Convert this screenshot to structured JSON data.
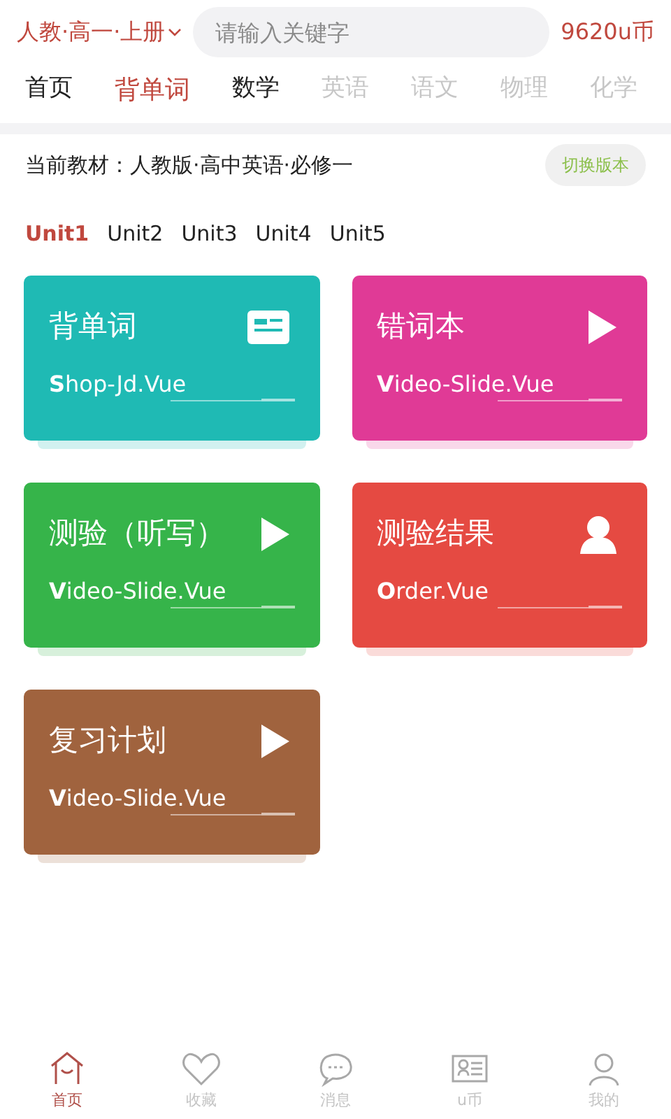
{
  "header": {
    "book_selector": "人教·高一·上册",
    "search": {
      "placeholder": "请输入关键字"
    },
    "coins": "9620u币"
  },
  "subject_tabs": [
    {
      "label": "首页",
      "selected": false,
      "dim": false
    },
    {
      "label": "背单词",
      "selected": true,
      "dim": false
    },
    {
      "label": "数学",
      "selected": false,
      "dim": false
    },
    {
      "label": "英语",
      "selected": false,
      "dim": true
    },
    {
      "label": "语文",
      "selected": false,
      "dim": true
    },
    {
      "label": "物理",
      "selected": false,
      "dim": true
    },
    {
      "label": "化学",
      "selected": false,
      "dim": true
    }
  ],
  "textbook": {
    "label": "当前教材：人教版·高中英语·必修一",
    "switch_button": "切换版本"
  },
  "units": [
    {
      "label": "Unit1",
      "selected": true
    },
    {
      "label": "Unit2",
      "selected": false
    },
    {
      "label": "Unit3",
      "selected": false
    },
    {
      "label": "Unit4",
      "selected": false
    },
    {
      "label": "Unit5",
      "selected": false
    }
  ],
  "cards": [
    {
      "title": "背单词",
      "subtitle": "**S**hop-Jd.Vue",
      "color": "#1fbab4",
      "kind": "card"
    },
    {
      "title": "错词本",
      "subtitle": "**V**ideo-Slide.Vue",
      "color": "#e03a96",
      "kind": "play"
    },
    {
      "title": "测验（听写）",
      "subtitle": "**V**ideo-Slide.Vue",
      "color": "#36b44a",
      "kind": "play"
    },
    {
      "title": "测验结果",
      "subtitle": "**O**rder.Vue",
      "color": "#e54a42",
      "kind": "user"
    },
    {
      "title": "复习计划",
      "subtitle": "**V**ideo-Slide.Vue",
      "color": "#a0633e",
      "kind": "play"
    }
  ],
  "bottom_nav": [
    {
      "label": "首页",
      "kind": "home",
      "selected": true
    },
    {
      "label": "收藏",
      "kind": "heart",
      "selected": false
    },
    {
      "label": "消息",
      "kind": "chat",
      "selected": false
    },
    {
      "label": "u币",
      "kind": "idcard",
      "selected": false
    },
    {
      "label": "我的",
      "kind": "user",
      "selected": false
    }
  ]
}
